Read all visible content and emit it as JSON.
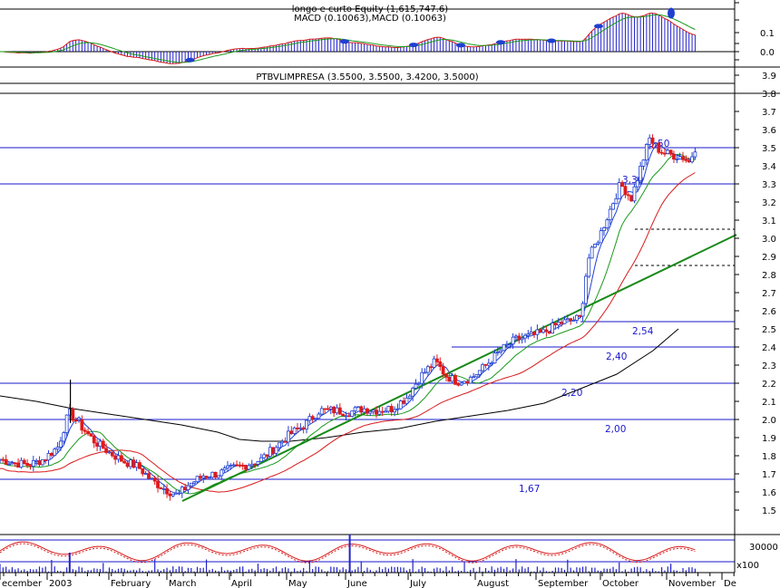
{
  "chart_data": [
    {
      "panel": "macd",
      "type": "line",
      "title": "longo e curto Equity (1,615,747.6)",
      "subtitle": "MACD (0.10063),MACD (0.10063)",
      "y_ticks": [
        "0.1",
        "0.0"
      ],
      "ylim": [
        -0.02,
        0.16
      ],
      "colors": {
        "frame": "#000000",
        "line1": "#d81a1a",
        "line2": "#1a9a1a",
        "histogram": "#2222c8",
        "markers": "#1f3fd0"
      }
    },
    {
      "panel": "price",
      "type": "candlestick",
      "title": "PTBVLIMPRESA (3.5500, 3.5500, 3.4200, 3.5000)",
      "y_ticks": [
        "3.9",
        "3.8",
        "3.7",
        "3.6",
        "3.5",
        "3.4",
        "3.3",
        "3.2",
        "3.1",
        "3.0",
        "2.9",
        "2.8",
        "2.7",
        "2.6",
        "2.5",
        "2.4",
        "2.3",
        "2.2",
        "2.1",
        "2.0",
        "1.9",
        "1.8",
        "1.7",
        "1.6",
        "1.5"
      ],
      "ylim": [
        1.42,
        3.95
      ],
      "x_labels": [
        "ecember",
        "2003",
        "February",
        "March",
        "April",
        "May",
        "June",
        "July",
        "August",
        "September",
        "October",
        "November",
        "De"
      ],
      "horizontal_levels": [
        {
          "value": 3.8,
          "label": ""
        },
        {
          "value": 3.5,
          "label": "3,50"
        },
        {
          "value": 3.3,
          "label": "3,30"
        },
        {
          "value": 2.54,
          "label": "2,54"
        },
        {
          "value": 2.4,
          "label": "2,40"
        },
        {
          "value": 2.2,
          "label": "2,20"
        },
        {
          "value": 2.0,
          "label": "2,00"
        },
        {
          "value": 1.67,
          "label": "1,67"
        }
      ],
      "dashed_levels": [
        3.05,
        2.85
      ],
      "trendline": {
        "from": [
          0.245,
          1.55
        ],
        "to": [
          1.0,
          3.02
        ]
      },
      "sma200": [
        [
          0.0,
          2.13
        ],
        [
          0.05,
          2.1
        ],
        [
          0.1,
          2.06
        ],
        [
          0.15,
          2.03
        ],
        [
          0.2,
          2.0
        ],
        [
          0.25,
          1.97
        ],
        [
          0.3,
          1.93
        ],
        [
          0.33,
          1.89
        ],
        [
          0.36,
          1.88
        ],
        [
          0.4,
          1.88
        ],
        [
          0.45,
          1.9
        ],
        [
          0.5,
          1.93
        ],
        [
          0.55,
          1.95
        ],
        [
          0.6,
          1.99
        ],
        [
          0.65,
          2.02
        ],
        [
          0.7,
          2.05
        ],
        [
          0.75,
          2.09
        ],
        [
          0.8,
          2.17
        ],
        [
          0.85,
          2.25
        ],
        [
          0.9,
          2.38
        ],
        [
          0.935,
          2.5
        ]
      ],
      "close": [
        [
          0.0,
          1.78
        ],
        [
          0.02,
          1.76
        ],
        [
          0.04,
          1.75
        ],
        [
          0.06,
          1.78
        ],
        [
          0.08,
          1.85
        ],
        [
          0.095,
          2.04
        ],
        [
          0.11,
          1.97
        ],
        [
          0.13,
          1.88
        ],
        [
          0.15,
          1.82
        ],
        [
          0.17,
          1.77
        ],
        [
          0.19,
          1.74
        ],
        [
          0.21,
          1.66
        ],
        [
          0.23,
          1.61
        ],
        [
          0.245,
          1.58
        ],
        [
          0.26,
          1.64
        ],
        [
          0.28,
          1.69
        ],
        [
          0.3,
          1.7
        ],
        [
          0.32,
          1.73
        ],
        [
          0.34,
          1.75
        ],
        [
          0.36,
          1.78
        ],
        [
          0.38,
          1.85
        ],
        [
          0.4,
          1.92
        ],
        [
          0.42,
          1.97
        ],
        [
          0.44,
          2.05
        ],
        [
          0.46,
          2.05
        ],
        [
          0.48,
          2.04
        ],
        [
          0.5,
          2.06
        ],
        [
          0.52,
          2.05
        ],
        [
          0.54,
          2.06
        ],
        [
          0.56,
          2.12
        ],
        [
          0.58,
          2.24
        ],
        [
          0.6,
          2.32
        ],
        [
          0.615,
          2.24
        ],
        [
          0.63,
          2.21
        ],
        [
          0.65,
          2.23
        ],
        [
          0.67,
          2.3
        ],
        [
          0.69,
          2.38
        ],
        [
          0.71,
          2.44
        ],
        [
          0.73,
          2.46
        ],
        [
          0.75,
          2.48
        ],
        [
          0.77,
          2.53
        ],
        [
          0.79,
          2.55
        ],
        [
          0.8,
          2.56
        ],
        [
          0.81,
          2.88
        ],
        [
          0.825,
          3.0
        ],
        [
          0.84,
          3.15
        ],
        [
          0.855,
          3.3
        ],
        [
          0.87,
          3.22
        ],
        [
          0.88,
          3.35
        ],
        [
          0.895,
          3.55
        ],
        [
          0.91,
          3.48
        ],
        [
          0.925,
          3.46
        ],
        [
          0.94,
          3.45
        ],
        [
          0.95,
          3.42
        ],
        [
          0.958,
          3.5
        ]
      ],
      "colors": {
        "frame": "#000000",
        "up": "#1f3fd0",
        "down": "#e01a1a",
        "ma_fast": "#1f3fd0",
        "ma_mid": "#1a9a1a",
        "ma_slow": "#d81a1a",
        "ma_long": "#000000",
        "trend": "#188a18",
        "level": "#1a1acc"
      }
    },
    {
      "panel": "volume",
      "type": "bar",
      "y_ticks": [
        "30000",
        "x100"
      ],
      "colors": {
        "oscillator": "#d81a1a",
        "volume": "#2222c8",
        "level": "#1a1acc"
      }
    }
  ]
}
